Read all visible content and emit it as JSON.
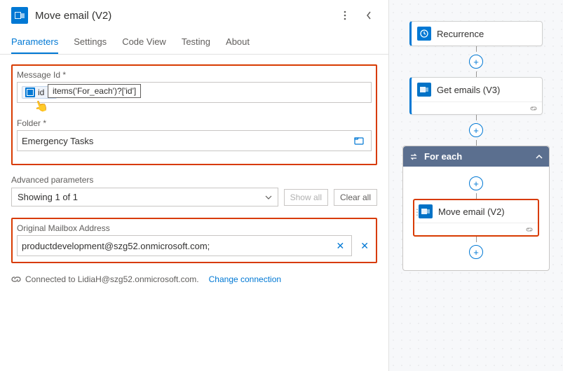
{
  "header": {
    "title": "Move email (V2)"
  },
  "tabs": [
    "Parameters",
    "Settings",
    "Code View",
    "Testing",
    "About"
  ],
  "activeTab": "Parameters",
  "messageId": {
    "label": "Message Id *",
    "tokenLabel": "id",
    "tooltip": "items('For_each')?['id']"
  },
  "folder": {
    "label": "Folder *",
    "value": "Emergency Tasks"
  },
  "advanced": {
    "heading": "Advanced parameters",
    "selector": "Showing 1 of 1",
    "showAll": "Show all",
    "clearAll": "Clear all"
  },
  "mailbox": {
    "label": "Original Mailbox Address",
    "value": "productdevelopment@szg52.onmicrosoft.com;"
  },
  "connection": {
    "text": "Connected to LidiaH@szg52.onmicrosoft.com.",
    "change": "Change connection"
  },
  "flow": {
    "recurrence": "Recurrence",
    "getEmails": "Get emails (V3)",
    "forEach": "For each",
    "moveEmail": "Move email (V2)"
  }
}
